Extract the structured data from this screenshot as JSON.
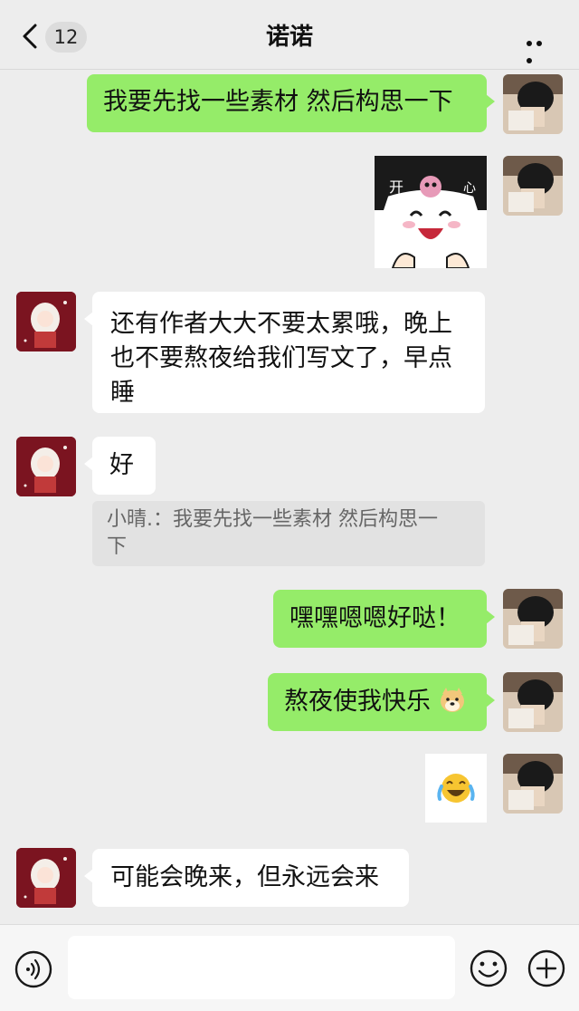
{
  "header": {
    "title": "诺诺",
    "unread_count": "12",
    "back_icon": "chevron-left-icon",
    "more_icon": "more-dots-icon"
  },
  "messages": [
    {
      "side": "self",
      "type": "text",
      "text": "我要先找一些素材 然后构思一下"
    },
    {
      "side": "self",
      "type": "sticker",
      "sticker_text_left": "开",
      "sticker_text_right": "心"
    },
    {
      "side": "other",
      "type": "text",
      "lines": [
        "还有作者大大不要太累哦，晚上",
        "也不要熬夜给我们写文了，早点",
        "睡"
      ]
    },
    {
      "side": "other",
      "type": "text",
      "text": "好"
    },
    {
      "side": "other",
      "type": "quote",
      "lines": [
        "小晴.：我要先找一些素材 然后构思一",
        "下"
      ]
    },
    {
      "side": "self",
      "type": "text",
      "text": "嘿嘿嗯嗯好哒！"
    },
    {
      "side": "self",
      "type": "text",
      "text": "熬夜使我快乐",
      "trailing_icon": "doge-emoji-icon"
    },
    {
      "side": "self",
      "type": "sticker",
      "icon": "laughing-crying-emoji-icon"
    },
    {
      "side": "other",
      "type": "text",
      "text": "可能会晚来，但永远会来"
    }
  ],
  "input_bar": {
    "placeholder": "",
    "voice_icon": "voice-icon",
    "emoji_icon": "emoji-icon",
    "add_icon": "add-icon"
  },
  "colors": {
    "background": "#ededed",
    "self_bubble": "#95ec69",
    "other_bubble": "#ffffff",
    "other_avatar": "#7b1420"
  }
}
